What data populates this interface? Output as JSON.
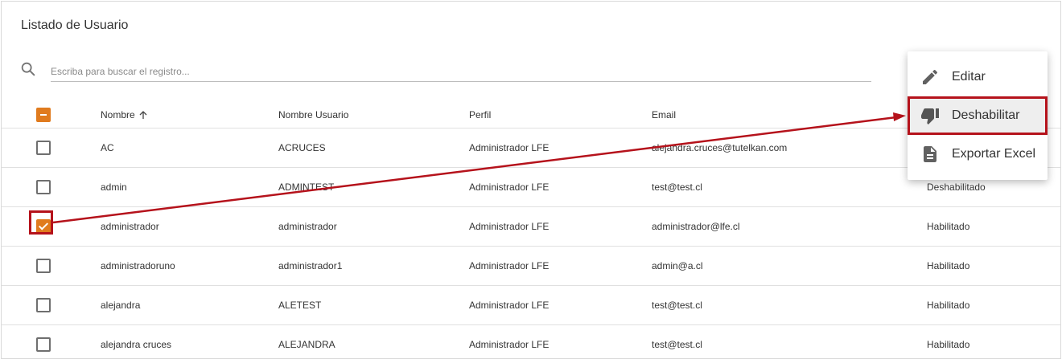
{
  "page": {
    "title": "Listado de Usuario"
  },
  "search": {
    "placeholder": "Escriba para buscar el registro..."
  },
  "table": {
    "columns": [
      "Nombre",
      "Nombre Usuario",
      "Perfil",
      "Email",
      ""
    ],
    "rows": [
      {
        "nombre": "AC",
        "usuario": "ACRUCES",
        "perfil": "Administrador LFE",
        "email": "alejandra.cruces@tutelkan.com",
        "estado": ""
      },
      {
        "nombre": "admin",
        "usuario": "ADMINTEST",
        "perfil": "Administrador LFE",
        "email": "test@test.cl",
        "estado": "Deshabilitado"
      },
      {
        "nombre": "administrador",
        "usuario": "administrador",
        "perfil": "Administrador LFE",
        "email": "administrador@lfe.cl",
        "estado": "Habilitado"
      },
      {
        "nombre": "administradoruno",
        "usuario": "administrador1",
        "perfil": "Administrador LFE",
        "email": "admin@a.cl",
        "estado": "Habilitado"
      },
      {
        "nombre": "alejandra",
        "usuario": "ALETEST",
        "perfil": "Administrador LFE",
        "email": "test@test.cl",
        "estado": "Habilitado"
      },
      {
        "nombre": "alejandra cruces",
        "usuario": "ALEJANDRA",
        "perfil": "Administrador LFE",
        "email": "test@test.cl",
        "estado": "Habilitado"
      }
    ]
  },
  "menu": {
    "items": [
      {
        "label": "Editar",
        "icon": "pencil-icon"
      },
      {
        "label": "Deshabilitar",
        "icon": "thumbs-down-icon"
      },
      {
        "label": "Exportar Excel",
        "icon": "document-icon"
      }
    ]
  },
  "colors": {
    "accent": "#e07b1e",
    "annotation": "#b5121b"
  }
}
